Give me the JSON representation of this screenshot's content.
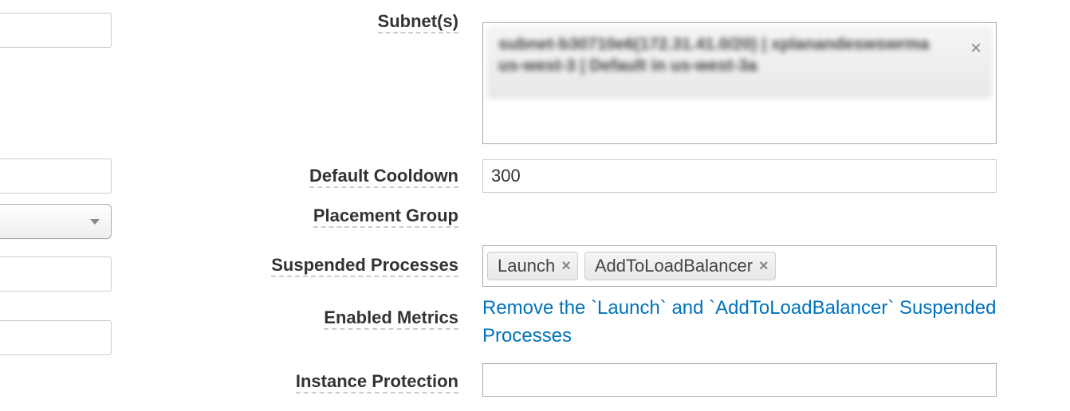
{
  "labels": {
    "subnets": "Subnet(s)",
    "default_cooldown": "Default Cooldown",
    "placement_group": "Placement Group",
    "suspended_processes": "Suspended Processes",
    "enabled_metrics": "Enabled Metrics",
    "instance_protection": "Instance Protection"
  },
  "values": {
    "subnet_tag": "subnet-b30710e6(172.31.41.0/20) | xplanandeswswrma us-west-3 | Default in us-west-3a",
    "default_cooldown": "300",
    "placement_group": "",
    "suspended_tags": [
      "Launch",
      "AddToLoadBalancer"
    ],
    "info_link": "Remove the `Launch` and `AddToLoadBalancer` Suspended Processes"
  }
}
